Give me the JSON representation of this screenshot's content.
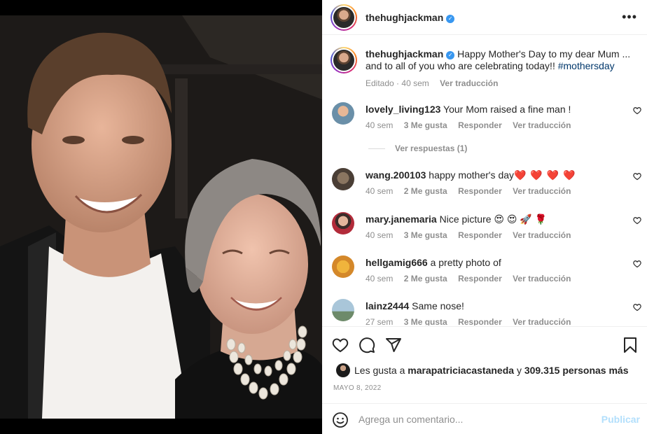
{
  "post": {
    "username": "thehughjackman",
    "verified_icon": "verified-badge-icon",
    "more_icon": "more-horizontal-icon"
  },
  "caption": {
    "username": "thehughjackman",
    "text": "Happy Mother's Day to my dear Mum ... and to all of you who are celebrating today!! ",
    "hashtag": "#mothersday",
    "edited": "Editado",
    "separator": "·",
    "age": "40 sem",
    "translate": "Ver traducción"
  },
  "comments": [
    {
      "username": "lovely_living123",
      "text": "Your Mom raised a fine man !",
      "age": "40 sem",
      "likes": "3 Me gusta",
      "reply": "Responder",
      "translate": "Ver traducción"
    },
    {
      "username": "wang.200103",
      "text": "happy mother's day",
      "emoji": "❤️ ❤️ ❤️ ❤️",
      "age": "40 sem",
      "likes": "2 Me gusta",
      "reply": "Responder",
      "translate": "Ver traducción"
    },
    {
      "username": "mary.janemaria",
      "text": "Nice picture",
      "emoji": "😍 😍 🚀 🌹",
      "age": "40 sem",
      "likes": "3 Me gusta",
      "reply": "Responder",
      "translate": "Ver traducción"
    },
    {
      "username": "hellgamig666",
      "text": "a pretty photo of",
      "age": "40 sem",
      "likes": "2 Me gusta",
      "reply": "Responder",
      "translate": "Ver traducción"
    },
    {
      "username": "lainz2444",
      "text": "Same nose!",
      "age": "27 sem",
      "likes": "3 Me gusta",
      "reply": "Responder",
      "translate": "Ver traducción"
    }
  ],
  "view_replies": "Ver respuestas (1)",
  "actions": {
    "like_icon": "heart-outline-icon",
    "comment_icon": "comment-bubble-icon",
    "share_icon": "paper-plane-icon",
    "save_icon": "bookmark-icon"
  },
  "likes": {
    "prefix": "Les gusta a",
    "user": "marapatriciacastaneda",
    "connector": "y",
    "count": "309.315 personas más"
  },
  "date": "MAYO 8, 2022",
  "add_comment": {
    "placeholder": "Agrega un comentario...",
    "publish": "Publicar",
    "emoji_icon": "smiley-icon"
  },
  "colors": {
    "verified": "#3897f0",
    "hashtag": "#00376b",
    "muted": "#8e8e8e",
    "publish_disabled": "#b2dffc",
    "emoji_heart": "#ed4956"
  }
}
